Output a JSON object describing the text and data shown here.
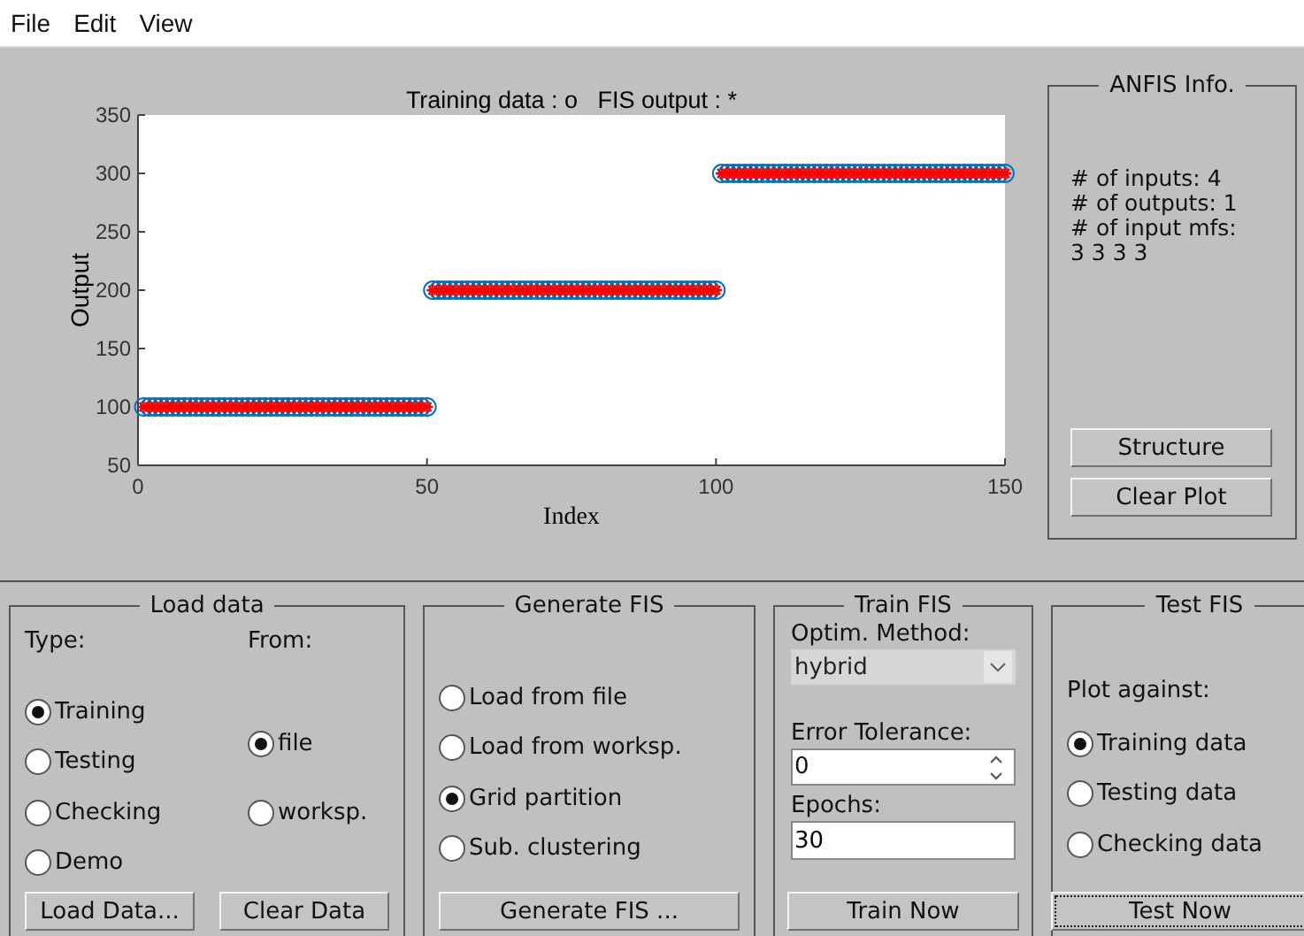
{
  "menu": [
    "File",
    "Edit",
    "View"
  ],
  "plot": {
    "chart_data": {
      "type": "scatter",
      "title": "Training data : o   FIS output : *",
      "xlabel": "Index",
      "ylabel": "Output",
      "xlim": [
        0,
        150
      ],
      "ylim": [
        50,
        350
      ],
      "xticks": [
        0,
        50,
        100,
        150
      ],
      "yticks": [
        50,
        100,
        150,
        200,
        250,
        300,
        350
      ],
      "x": [
        1,
        2,
        3,
        4,
        5,
        6,
        7,
        8,
        9,
        10,
        11,
        12,
        13,
        14,
        15,
        16,
        17,
        18,
        19,
        20,
        21,
        22,
        23,
        24,
        25,
        26,
        27,
        28,
        29,
        30,
        31,
        32,
        33,
        34,
        35,
        36,
        37,
        38,
        39,
        40,
        41,
        42,
        43,
        44,
        45,
        46,
        47,
        48,
        49,
        50,
        51,
        52,
        53,
        54,
        55,
        56,
        57,
        58,
        59,
        60,
        61,
        62,
        63,
        64,
        65,
        66,
        67,
        68,
        69,
        70,
        71,
        72,
        73,
        74,
        75,
        76,
        77,
        78,
        79,
        80,
        81,
        82,
        83,
        84,
        85,
        86,
        87,
        88,
        89,
        90,
        91,
        92,
        93,
        94,
        95,
        96,
        97,
        98,
        99,
        100,
        101,
        102,
        103,
        104,
        105,
        106,
        107,
        108,
        109,
        110,
        111,
        112,
        113,
        114,
        115,
        116,
        117,
        118,
        119,
        120,
        121,
        122,
        123,
        124,
        125,
        126,
        127,
        128,
        129,
        130,
        131,
        132,
        133,
        134,
        135,
        136,
        137,
        138,
        139,
        140,
        141,
        142,
        143,
        144,
        145,
        146,
        147,
        148,
        149,
        150
      ],
      "series": [
        {
          "color": "#0072bd",
          "values": [
            100,
            100,
            100,
            100,
            100,
            100,
            100,
            100,
            100,
            100,
            100,
            100,
            100,
            100,
            100,
            100,
            100,
            100,
            100,
            100,
            100,
            100,
            100,
            100,
            100,
            100,
            100,
            100,
            100,
            100,
            100,
            100,
            100,
            100,
            100,
            100,
            100,
            100,
            100,
            100,
            100,
            100,
            100,
            100,
            100,
            100,
            100,
            100,
            100,
            100,
            200,
            200,
            200,
            200,
            200,
            200,
            200,
            200,
            200,
            200,
            200,
            200,
            200,
            200,
            200,
            200,
            200,
            200,
            200,
            200,
            200,
            200,
            200,
            200,
            200,
            200,
            200,
            200,
            200,
            200,
            200,
            200,
            200,
            200,
            200,
            200,
            200,
            200,
            200,
            200,
            200,
            200,
            200,
            200,
            200,
            200,
            200,
            200,
            200,
            200,
            300,
            300,
            300,
            300,
            300,
            300,
            300,
            300,
            300,
            300,
            300,
            300,
            300,
            300,
            300,
            300,
            300,
            300,
            300,
            300,
            300,
            300,
            300,
            300,
            300,
            300,
            300,
            300,
            300,
            300,
            300,
            300,
            300,
            300,
            300,
            300,
            300,
            300,
            300,
            300,
            300,
            300,
            300,
            300,
            300,
            300,
            300,
            300,
            300,
            300
          ]
        },
        {
          "color": "#ff0000",
          "values": [
            100,
            100,
            100,
            100,
            100,
            100,
            100,
            100,
            100,
            100,
            100,
            100,
            100,
            100,
            100,
            100,
            100,
            100,
            100,
            100,
            100,
            100,
            100,
            100,
            100,
            100,
            100,
            100,
            100,
            100,
            100,
            100,
            100,
            100,
            100,
            100,
            100,
            100,
            100,
            100,
            100,
            100,
            100,
            100,
            100,
            100,
            100,
            100,
            100,
            100,
            200,
            200,
            200,
            200,
            200,
            200,
            200,
            200,
            200,
            200,
            200,
            200,
            200,
            200,
            200,
            200,
            200,
            200,
            200,
            200,
            200,
            200,
            200,
            200,
            200,
            200,
            200,
            200,
            200,
            200,
            200,
            200,
            200,
            200,
            200,
            200,
            200,
            200,
            200,
            200,
            200,
            200,
            200,
            200,
            200,
            200,
            200,
            200,
            200,
            200,
            300,
            300,
            300,
            300,
            300,
            300,
            300,
            300,
            300,
            300,
            300,
            300,
            300,
            300,
            300,
            300,
            300,
            300,
            300,
            300,
            300,
            300,
            300,
            300,
            300,
            300,
            300,
            300,
            300,
            300,
            300,
            300,
            300,
            300,
            300,
            300,
            300,
            300,
            300,
            300,
            300,
            300,
            300,
            300,
            300,
            300,
            300,
            300,
            300,
            300
          ]
        }
      ]
    }
  },
  "anfis_info": {
    "title": "ANFIS Info.",
    "lines": [
      "# of inputs: 4",
      "# of outputs: 1",
      "# of input mfs:",
      "3 3 3 3"
    ],
    "buttons": [
      "Structure",
      "Clear Plot"
    ]
  },
  "load_data": {
    "title": "Load data",
    "type_label": "Type:",
    "from_label": "From:",
    "types": [
      {
        "label": "Training",
        "selected": true
      },
      {
        "label": "Testing",
        "selected": false
      },
      {
        "label": "Checking",
        "selected": false
      },
      {
        "label": "Demo",
        "selected": false
      }
    ],
    "sources": [
      {
        "label": "file",
        "selected": true
      },
      {
        "label": "worksp.",
        "selected": false
      }
    ],
    "buttons": [
      "Load Data...",
      "Clear Data"
    ]
  },
  "generate_fis": {
    "title": "Generate FIS",
    "options": [
      {
        "label": "Load from file",
        "selected": false
      },
      {
        "label": "Load from worksp.",
        "selected": false
      },
      {
        "label": "Grid partition",
        "selected": true
      },
      {
        "label": "Sub. clustering",
        "selected": false
      }
    ],
    "button": "Generate FIS ..."
  },
  "train_fis": {
    "title": "Train FIS",
    "method_label": "Optim. Method:",
    "method": "hybrid",
    "tolerance_label": "Error Tolerance:",
    "tolerance": "0",
    "epochs_label": "Epochs:",
    "epochs": "30",
    "button": "Train Now"
  },
  "test_fis": {
    "title": "Test FIS",
    "plot_label": "Plot against:",
    "options": [
      {
        "label": "Training data",
        "selected": true
      },
      {
        "label": "Testing data",
        "selected": false
      },
      {
        "label": "Checking data",
        "selected": false
      }
    ],
    "button": {
      "label": "Test Now",
      "focused": true
    }
  }
}
